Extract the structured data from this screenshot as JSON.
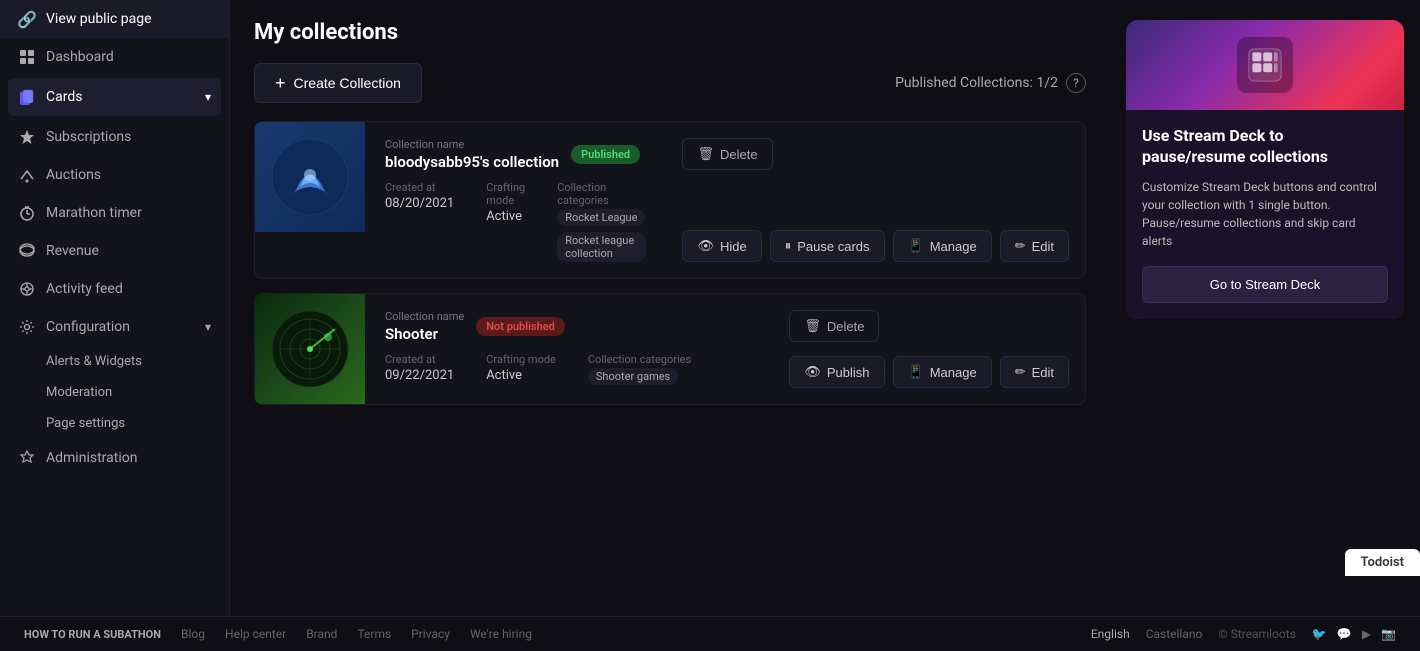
{
  "sidebar": {
    "items": [
      {
        "id": "view-public-page",
        "label": "View public page",
        "icon": "🔗"
      },
      {
        "id": "dashboard",
        "label": "Dashboard",
        "icon": "⊞"
      },
      {
        "id": "cards",
        "label": "Cards",
        "icon": "🃏",
        "active": true,
        "hasChevron": true
      },
      {
        "id": "subscriptions",
        "label": "Subscriptions",
        "icon": "⭐"
      },
      {
        "id": "auctions",
        "label": "Auctions",
        "icon": "⚡"
      },
      {
        "id": "marathon-timer",
        "label": "Marathon timer",
        "icon": "⏱"
      },
      {
        "id": "revenue",
        "label": "Revenue",
        "icon": "💰"
      },
      {
        "id": "activity-feed",
        "label": "Activity feed",
        "icon": "📡"
      },
      {
        "id": "configuration",
        "label": "Configuration",
        "icon": "⚙",
        "hasChevron": true
      },
      {
        "id": "alerts-widgets",
        "label": "Alerts & Widgets",
        "icon": "",
        "sub": true
      },
      {
        "id": "moderation",
        "label": "Moderation",
        "icon": "",
        "sub": true
      },
      {
        "id": "page-settings",
        "label": "Page settings",
        "icon": "",
        "sub": true
      },
      {
        "id": "administration",
        "label": "Administration",
        "icon": "🛡"
      }
    ]
  },
  "page": {
    "title": "My collections",
    "toolbar": {
      "create_label": "Create Collection",
      "published_info": "Published Collections: 1/2"
    }
  },
  "collections": [
    {
      "id": "collection-1",
      "thumbnail_type": "rocket",
      "status": "Published",
      "status_type": "published",
      "name_label": "Collection name",
      "name": "bloodysabb95's collection",
      "created_label": "Created at",
      "created_at": "08/20/2021",
      "crafting_label": "Crafting mode",
      "crafting_mode": "Active",
      "categories_label": "Collection categories",
      "categories": [
        "Rocket League",
        "Rocket league collection"
      ],
      "actions": {
        "delete": "Delete",
        "hide": "Hide",
        "pause": "Pause cards",
        "manage": "Manage",
        "edit": "Edit"
      }
    },
    {
      "id": "collection-2",
      "thumbnail_type": "shooter",
      "status": "Not published",
      "status_type": "not-published",
      "name_label": "Collection name",
      "name": "Shooter",
      "created_label": "Created at",
      "created_at": "09/22/2021",
      "crafting_label": "Crafting mode",
      "crafting_mode": "Active",
      "categories_label": "Collection categories",
      "categories": [
        "Shooter games"
      ],
      "actions": {
        "delete": "Delete",
        "publish": "Publish",
        "manage": "Manage",
        "edit": "Edit"
      }
    }
  ],
  "stream_deck": {
    "title": "Use Stream Deck to pause/resume collections",
    "description": "Customize Stream Deck buttons and control your collection with 1 single button. Pause/resume collections and skip card alerts",
    "cta": "Go to Stream Deck"
  },
  "footer": {
    "links": [
      {
        "label": "HOW TO RUN A SUBATHON"
      },
      {
        "label": "Blog"
      },
      {
        "label": "Help center"
      },
      {
        "label": "Brand"
      },
      {
        "label": "Terms"
      },
      {
        "label": "Privacy"
      },
      {
        "label": "We're hiring"
      }
    ],
    "copyright": "© Streamloots",
    "lang_options": [
      "English",
      "Castellano"
    ]
  },
  "todoist": {
    "label": "Todoist"
  }
}
